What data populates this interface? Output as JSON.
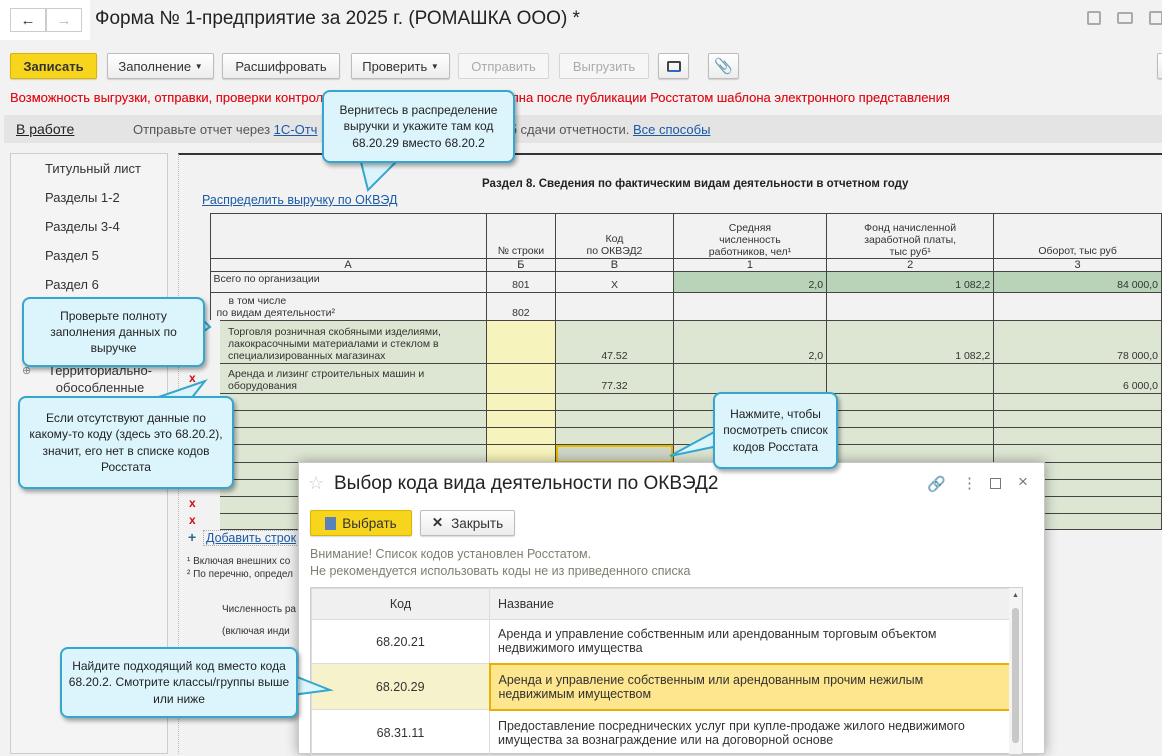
{
  "window": {
    "title": "Форма № 1-предприятие за 2025 г. (РОМАШКА ООО) *",
    "back_icon": "arrow-left",
    "forward_icon": "arrow-right"
  },
  "toolbar": {
    "save": "Записать",
    "fill": "Заполнение",
    "decode": "Расшифровать",
    "check": "Проверить",
    "send": "Отправить",
    "export": "Выгрузить"
  },
  "warning": "Возможность выгрузки, отправки, проверки контрольных соотношений будет доступна после публикации Росстатом шаблона электронного представления",
  "warning_visible": "Возможность выгрузки, отправки, проверки контро",
  "warning_visible2": "упна после публикации Росстатом шаблона электронного представления",
  "status": {
    "state": "В работе",
    "text": "Отправьте отчет через ",
    "link": "1С-Отч",
    "text2": "б сдачи отчетности. ",
    "all_ways": "Все способы"
  },
  "sidebar": {
    "items": [
      "Титульный лист",
      "Разделы 1-2",
      "Разделы 3-4",
      "Раздел 5",
      "Раздел 6"
    ],
    "branch": "Территориально-обособленные"
  },
  "form": {
    "section_title": "Раздел 8. Сведения по фактическим видам деятельности в отчетном году",
    "distribute_link": "Распределить выручку по ОКВЭД",
    "headers": [
      "",
      "№ строки",
      "Код\nпо ОКВЭД2",
      "Средняя численность работников, чел¹",
      "Фонд начисленной заработной платы, тыс руб¹",
      "Оборот, тыс руб"
    ],
    "letters": [
      "А",
      "Б",
      "В",
      "1",
      "2",
      "3"
    ],
    "total": {
      "label": "Всего по организации",
      "line": "801",
      "code": "Х",
      "workers": "2,0",
      "payroll": "1 082,2",
      "turnover": "84 000,0"
    },
    "incl": {
      "label1": "в том числе",
      "label2": "по видам деятельности²",
      "line": "802"
    },
    "rows": [
      {
        "name": "Торговля розничная скобяными изделиями, лакокрасочными материалами и стеклом в специализированных магазинах",
        "code": "47.52",
        "workers": "2,0",
        "payroll": "1 082,2",
        "turnover": "78 000,0"
      },
      {
        "name": "Аренда и лизинг строительных машин и оборудования",
        "code": "77.32",
        "workers": "",
        "payroll": "",
        "turnover": "6 000,0"
      }
    ],
    "delete_mark": "x",
    "add_row": "Добавить строк",
    "footnote1": "¹ Включая внешних со",
    "footnote2": "² По перечню, определ",
    "extra1": "Численность ра",
    "extra2": "(включая инди"
  },
  "dialog": {
    "title": "Выбор кода вида деятельности по ОКВЭД2",
    "select": "Выбрать",
    "close": "Закрыть",
    "notice1": "Внимание! Список кодов установлен Росстатом.",
    "notice2": "Не рекомендуется использовать коды не из приведенного списка",
    "col_code": "Код",
    "col_name": "Название",
    "rows": [
      {
        "code": "68.20.21",
        "name": "Аренда и управление собственным или арендованным торговым объектом недвижимого имущества"
      },
      {
        "code": "68.20.29",
        "name": "Аренда и управление собственным или арендованным прочим нежилым недвижимым имуществом",
        "selected": true
      },
      {
        "code": "68.31.11",
        "name": "Предоставление посреднических услуг при купле-продаже жилого недвижимого имущества за вознаграждение или на договорной основе"
      }
    ]
  },
  "callouts": {
    "c1": "Вернитесь в распределение выручки и укажите там код 68.20.29 вместо 68.20.2",
    "c2": "Проверьте полноту заполнения данных по выручке",
    "c3": "Если отсутствуют данные по какому-то коду (здесь это 68.20.2), значит, его нет в списке кодов Росстата",
    "c4": "Нажмите, чтобы посмотреть список кодов Росстата",
    "c5": "Найдите подходящий код вместо кода 68.20.2. Смотрите классы/группы выше или ниже"
  },
  "colors": {
    "accent": "#f7d51d",
    "warning": "#e0101a",
    "link": "#1a5aa6",
    "callout": "#dcf5fc"
  }
}
